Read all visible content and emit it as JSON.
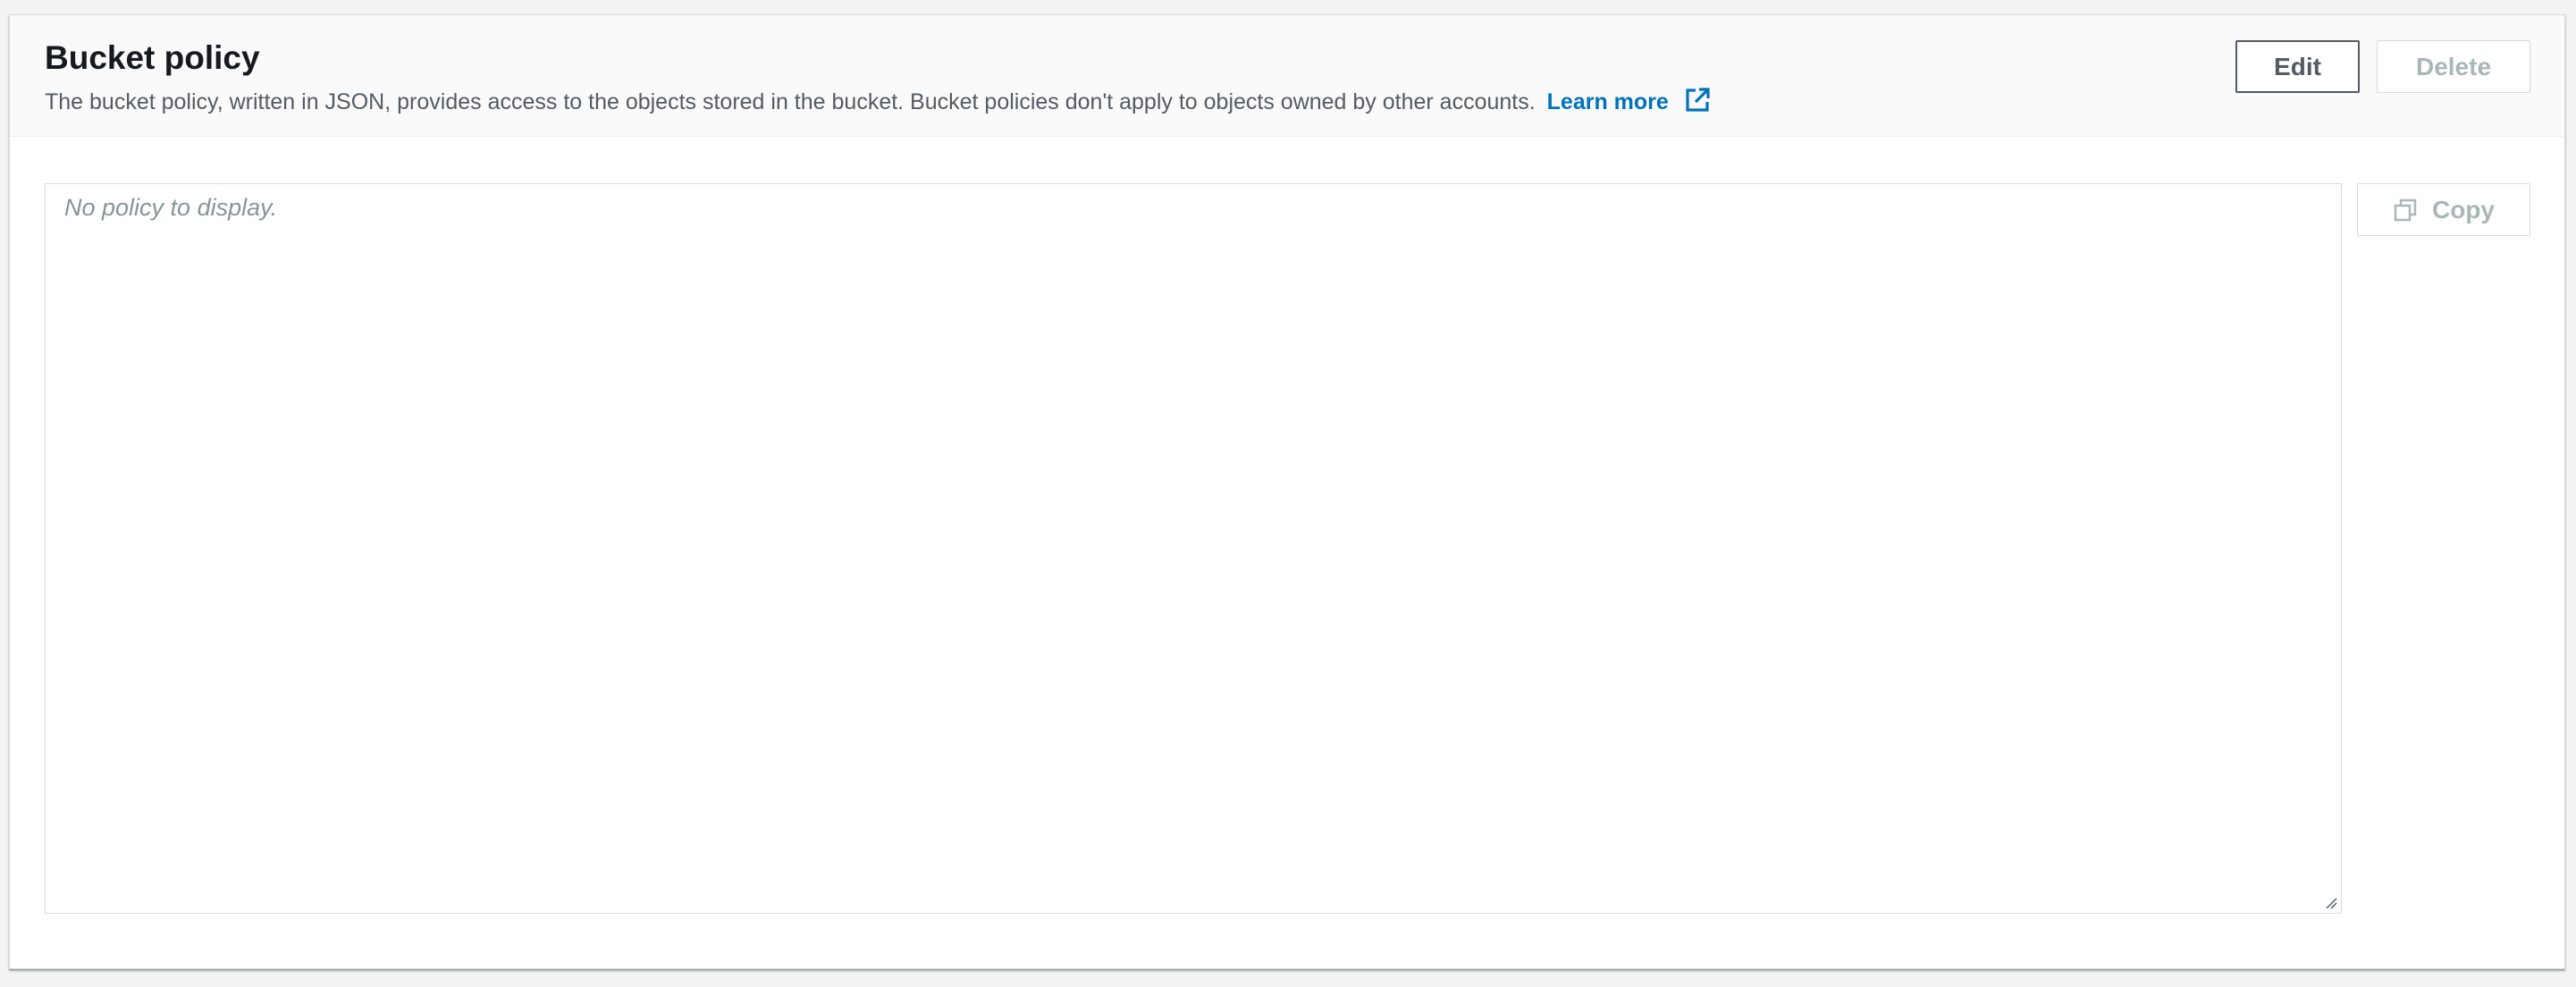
{
  "section": {
    "title": "Bucket policy",
    "description": "The bucket policy, written in JSON, provides access to the objects stored in the bucket. Bucket policies don't apply to objects owned by other accounts.",
    "learn_more_label": "Learn more",
    "learn_more_icon": "external-link-icon"
  },
  "actions": {
    "edit_label": "Edit",
    "delete_label": "Delete",
    "delete_disabled": true
  },
  "policy": {
    "placeholder": "No policy to display.",
    "copy_label": "Copy",
    "copy_icon": "copy-icon",
    "copy_disabled": true
  },
  "colors": {
    "link": "#0073bb",
    "title": "#16191f",
    "body_text": "#545b64",
    "disabled_text": "#aab7b8",
    "border": "#d5dbdb"
  }
}
